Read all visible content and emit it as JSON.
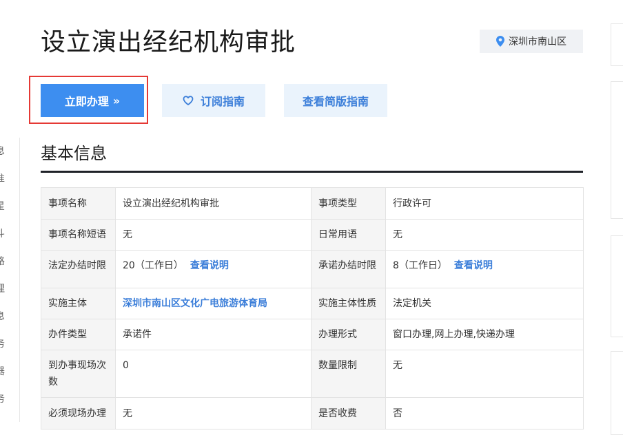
{
  "page": {
    "title": "设立演出经纪机构审批",
    "location": "深圳市南山区"
  },
  "actions": {
    "apply": "立即办理",
    "apply_chevron": "»",
    "subscribe": "订阅指南",
    "simple_guide": "查看简版指南"
  },
  "left_nav": {
    "chars": [
      "息",
      "准",
      "星",
      "斗",
      "路",
      "理",
      "息",
      "务",
      "器",
      "务"
    ]
  },
  "section": {
    "title": "基本信息"
  },
  "info": {
    "row1": {
      "l1": "事项名称",
      "v1": "设立演出经纪机构审批",
      "l2": "事项类型",
      "v2": "行政许可"
    },
    "row2": {
      "l1": "事项名称短语",
      "v1": "无",
      "l2": "日常用语",
      "v2": "无"
    },
    "row3": {
      "l1": "法定办结时限",
      "v1": "20（工作日）",
      "v1_link": "查看说明",
      "l2": "承诺办结时限",
      "v2": "8（工作日）",
      "v2_link": "查看说明"
    },
    "row4": {
      "l1": "实施主体",
      "v1": "深圳市南山区文化广电旅游体育局",
      "l2": "实施主体性质",
      "v2": "法定机关"
    },
    "row5": {
      "l1": "办件类型",
      "v1": "承诺件",
      "l2": "办理形式",
      "v2": "窗口办理,网上办理,快递办理"
    },
    "row6": {
      "l1": "到办事现场次数",
      "v1": "0",
      "l2": "数量限制",
      "v2": "无"
    },
    "row7": {
      "l1": "必须现场办理",
      "v1": "无",
      "l2": "是否收费",
      "v2": "否"
    }
  }
}
